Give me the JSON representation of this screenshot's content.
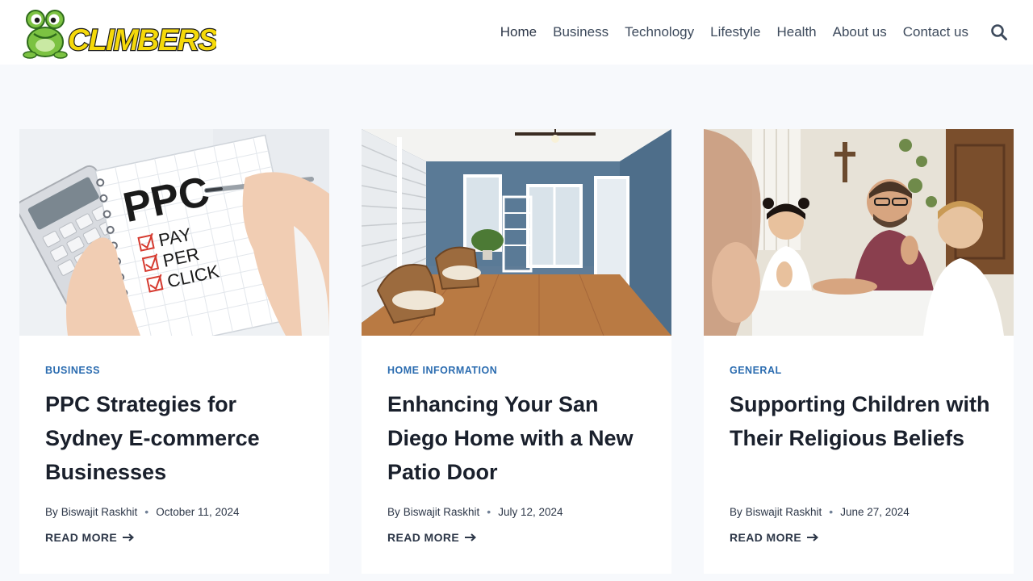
{
  "site": {
    "logo_text": "CLIMBERS"
  },
  "nav": {
    "items": [
      {
        "label": "Home"
      },
      {
        "label": "Business"
      },
      {
        "label": "Technology"
      },
      {
        "label": "Lifestyle"
      },
      {
        "label": "Health"
      },
      {
        "label": "About us"
      },
      {
        "label": "Contact us"
      }
    ],
    "search_icon": "search-icon"
  },
  "posts": [
    {
      "category": "BUSINESS",
      "title": "PPC Strategies for Sydney E-commerce Businesses",
      "by": "By",
      "author": "Biswajit Raskhit",
      "date": "October 11, 2024",
      "read_more": "READ MORE",
      "image_text": {
        "headline": "PPC",
        "line1": "PAY",
        "line2": "PER",
        "line3": "CLICK"
      }
    },
    {
      "category": "HOME INFORMATION",
      "title": "Enhancing Your San Diego Home with a New Patio Door",
      "by": "By",
      "author": "Biswajit Raskhit",
      "date": "July 12, 2024",
      "read_more": "READ MORE"
    },
    {
      "category": "GENERAL",
      "title": "Supporting Children with Their Religious Beliefs",
      "by": "By",
      "author": "Biswajit Raskhit",
      "date": "June 27, 2024",
      "read_more": "READ MORE"
    }
  ],
  "colors": {
    "accent": "#2b6cb0",
    "background": "#f7f9fc",
    "logo_green": "#7cc242",
    "logo_yellow": "#f5d90a"
  }
}
